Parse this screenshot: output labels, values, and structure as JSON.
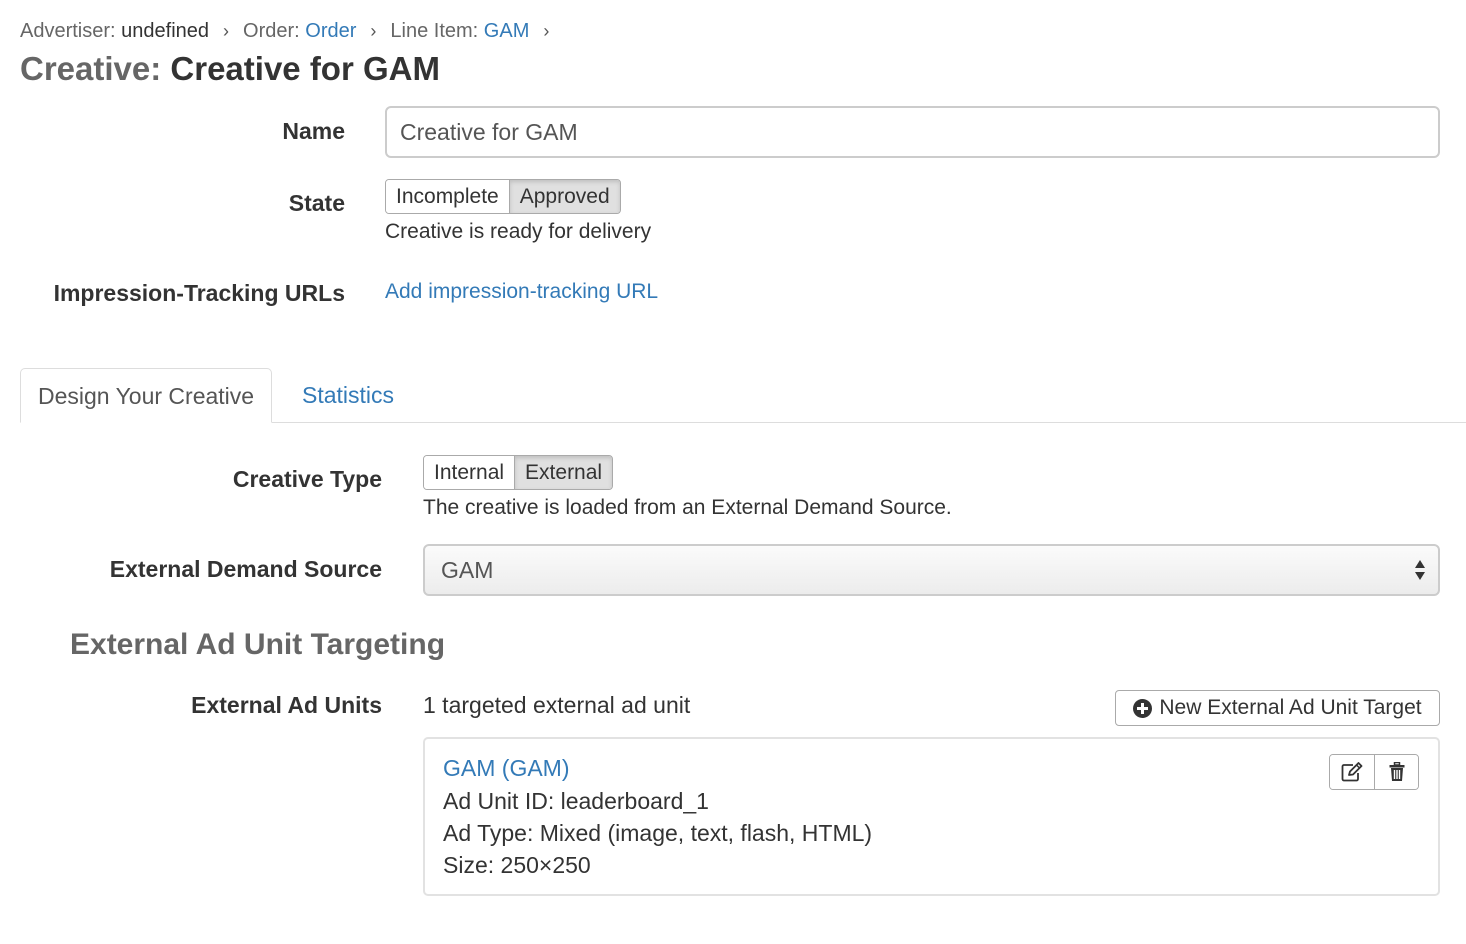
{
  "breadcrumb": {
    "advertiser_label": "Advertiser:",
    "advertiser_value": "undefined",
    "order_label": "Order:",
    "order_value": "Order",
    "line_item_label": "Line Item:",
    "line_item_value": "GAM",
    "separator": "›"
  },
  "page": {
    "title_prefix": "Creative:",
    "title_name": "Creative for GAM"
  },
  "form": {
    "name_label": "Name",
    "name_value": "Creative for GAM",
    "state_label": "State",
    "state_options": [
      "Incomplete",
      "Approved"
    ],
    "state_selected": "Approved",
    "state_help": "Creative is ready for delivery",
    "tracking_label": "Impression-Tracking URLs",
    "tracking_link": "Add impression-tracking URL"
  },
  "tabs": [
    {
      "label": "Design Your Creative",
      "active": true
    },
    {
      "label": "Statistics",
      "active": false
    }
  ],
  "design": {
    "creative_type_label": "Creative Type",
    "creative_type_options": [
      "Internal",
      "External"
    ],
    "creative_type_selected": "External",
    "creative_type_help": "The creative is loaded from an External Demand Source.",
    "demand_source_label": "External Demand Source",
    "demand_source_value": "GAM",
    "targeting_title": "External Ad Unit Targeting",
    "ad_units_label": "External Ad Units",
    "ad_units_count_text": "1 targeted external ad unit",
    "new_target_button": "New External Ad Unit Target",
    "ad_units": [
      {
        "title": "GAM (GAM)",
        "ad_unit_id": "Ad Unit ID: leaderboard_1",
        "ad_type": "Ad Type: Mixed (image, text, flash, HTML)",
        "size": "Size: 250×250"
      }
    ]
  },
  "icons": {
    "new_target": "plus-circle-icon",
    "edit": "edit-icon",
    "delete": "trash-icon",
    "select": "sort-arrows-icon"
  },
  "colors": {
    "link": "#337ab7",
    "text": "#333333",
    "muted": "#666666",
    "border": "#cccccc",
    "active_toggle": "#e0e0e0"
  }
}
